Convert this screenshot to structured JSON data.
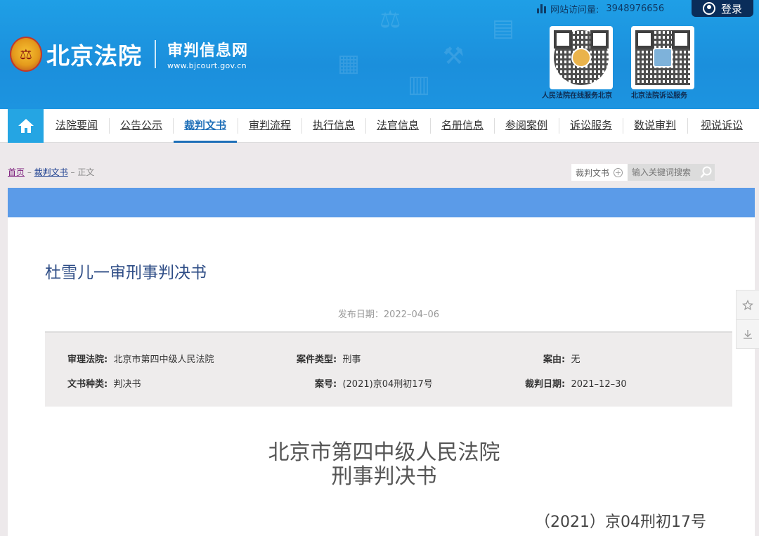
{
  "header": {
    "visit_label": "网站访问量:",
    "visit_count": "3948976656",
    "login_label": "登录",
    "logo_name": "北京法院",
    "logo_subtitle": "审判信息网",
    "logo_url": "www.bjcourt.gov.cn",
    "qr_codes": [
      {
        "caption": "人民法院在线服务北京",
        "icon": "miniprogram-qr-icon"
      },
      {
        "caption": "北京法院诉讼服务",
        "icon": "qr-code-icon"
      }
    ]
  },
  "nav": {
    "home_icon": "home-icon",
    "items": [
      {
        "label": "法院要闻"
      },
      {
        "label": "公告公示"
      },
      {
        "label": "裁判文书",
        "active": true
      },
      {
        "label": "审判流程"
      },
      {
        "label": "执行信息"
      },
      {
        "label": "法官信息"
      },
      {
        "label": "名册信息"
      },
      {
        "label": "参阅案例"
      },
      {
        "label": "诉讼服务"
      },
      {
        "label": "数说审判"
      },
      {
        "label": "视说诉讼"
      }
    ]
  },
  "breadcrumb": {
    "home": "首页",
    "section": "裁判文书",
    "current": "正文",
    "separator": "–"
  },
  "search": {
    "category": "裁判文书",
    "placeholder": "输入关键词搜索"
  },
  "document": {
    "title": "杜雪儿一审刑事判决书",
    "publish_date": "发布日期：2022–04–06",
    "meta": {
      "court_label": "审理法院:",
      "court_value": "北京市第四中级人民法院",
      "case_type_label": "案件类型:",
      "case_type_value": "刑事",
      "cause_label": "案由:",
      "cause_value": "无",
      "doc_type_label": "文书种类:",
      "doc_type_value": "判决书",
      "case_no_label": "案号:",
      "case_no_value": "(2021)京04刑初17号",
      "judgment_date_label": "裁判日期:",
      "judgment_date_value": "2021–12–30"
    },
    "court_name": "北京市第四中级人民法院",
    "doc_kind": "刑事判决书",
    "case_number": "（2021）京04刑初17号"
  },
  "side_tools": [
    "star-icon",
    "download-icon"
  ]
}
